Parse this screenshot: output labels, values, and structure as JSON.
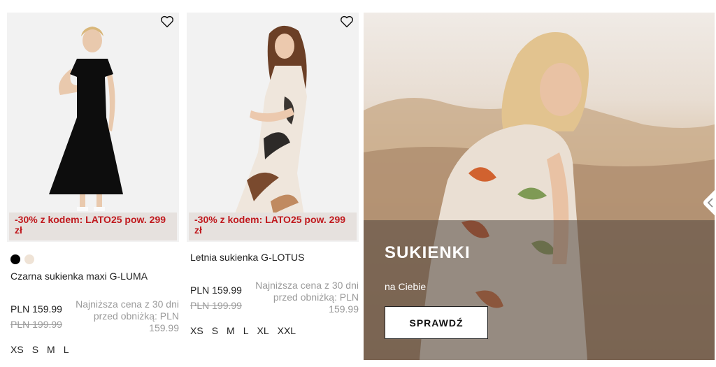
{
  "products": [
    {
      "name": "Czarna sukienka maxi G-LUMA",
      "promo": "-30% z kodem: LATO25 pow. 299 zł",
      "price_current": "PLN 159.99",
      "price_old": "PLN 199.99",
      "lowest_price_note": "Najniższa cena z 30 dni przed obniżką: PLN 159.99",
      "colors": [
        "#000000",
        "#efe3d6"
      ],
      "sizes": [
        "XS",
        "S",
        "M",
        "L"
      ],
      "favorite_icon": "heart-icon"
    },
    {
      "name": "Letnia sukienka G-LOTUS",
      "promo": "-30% z kodem: LATO25 pow. 299 zł",
      "price_current": "PLN 159.99",
      "price_old": "PLN 199.99",
      "lowest_price_note": "Najniższa cena z 30 dni przed obniżką: PLN 159.99",
      "sizes": [
        "XS",
        "S",
        "M",
        "L",
        "XL",
        "XXL"
      ],
      "favorite_icon": "heart-icon"
    }
  ],
  "banner": {
    "title": "SUKIENKI",
    "subtitle": "na Ciebie",
    "cta": "SPRAWDŹ"
  },
  "colors": {
    "promo_text": "#c0191e",
    "promo_bg": "#e6e1de",
    "muted_text": "#9a9a9a"
  }
}
